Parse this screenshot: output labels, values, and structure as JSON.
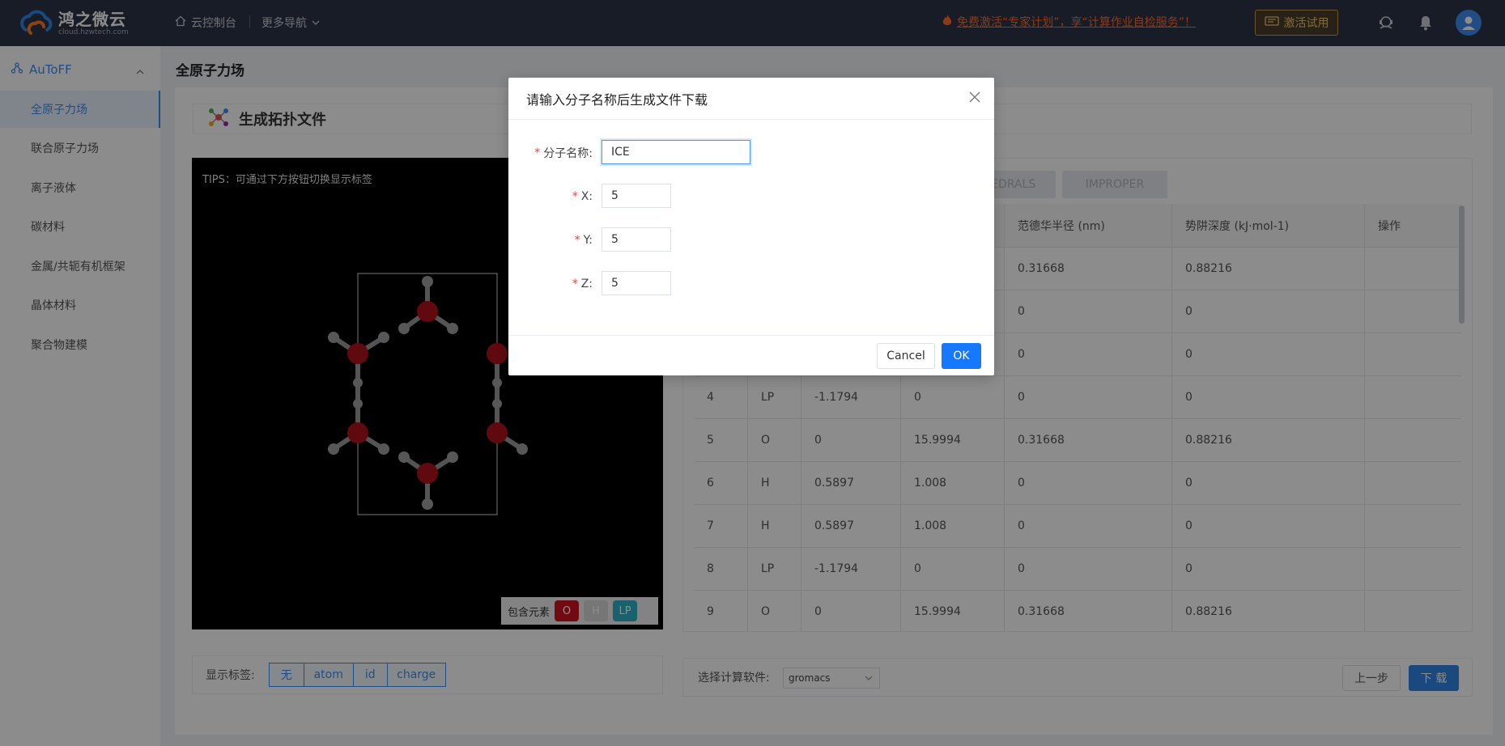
{
  "header": {
    "logo_cn": "鸿之微云",
    "logo_en": "cloud.hzwtech.com",
    "console_label": "云控制台",
    "more_nav_label": "更多导航",
    "promo_text": "免费激活“专家计划”，享“计算作业自检服务”！",
    "trial_label": "激活试用"
  },
  "sidebar": {
    "group_label": "AuToFF",
    "items": [
      {
        "label": "全原子力场"
      },
      {
        "label": "联合原子力场"
      },
      {
        "label": "离子液体"
      },
      {
        "label": "碳材料"
      },
      {
        "label": "金属/共轭有机框架"
      },
      {
        "label": "晶体材料"
      },
      {
        "label": "聚合物建模"
      }
    ]
  },
  "page": {
    "title": "全原子力场",
    "section_title": "生成拓扑文件"
  },
  "viewer": {
    "tips": "TIPS：可通过下方按钮切换显示标签",
    "legend_label": "包含元素",
    "elements": [
      {
        "label": "O",
        "color": "#d0141f"
      },
      {
        "label": "H",
        "color": "#d8d8d8"
      },
      {
        "label": "LP",
        "color": "#2bb3c8"
      }
    ]
  },
  "table": {
    "tabs": [
      "DIHEDRALS",
      "IMPROPER"
    ],
    "headers": [
      "",
      "",
      "",
      "",
      "范德华半径 (nm)",
      "势阱深度 (kJ·mol-1)",
      "操作"
    ],
    "rows": [
      [
        "",
        "",
        "",
        "",
        "0.31668",
        "0.88216",
        ""
      ],
      [
        "",
        "",
        "",
        "",
        "0",
        "0",
        ""
      ],
      [
        "",
        "",
        "",
        "",
        "0",
        "0",
        ""
      ],
      [
        "4",
        "LP",
        "-1.1794",
        "0",
        "0",
        "0",
        ""
      ],
      [
        "5",
        "O",
        "0",
        "15.9994",
        "0.31668",
        "0.88216",
        ""
      ],
      [
        "6",
        "H",
        "0.5897",
        "1.008",
        "0",
        "0",
        ""
      ],
      [
        "7",
        "H",
        "0.5897",
        "1.008",
        "0",
        "0",
        ""
      ],
      [
        "8",
        "LP",
        "-1.1794",
        "0",
        "0",
        "0",
        ""
      ],
      [
        "9",
        "O",
        "0",
        "15.9994",
        "0.31668",
        "0.88216",
        ""
      ]
    ]
  },
  "labels_bar": {
    "label": "显示标签:",
    "options": [
      "无",
      "atom",
      "id",
      "charge"
    ]
  },
  "software_bar": {
    "label": "选择计算软件:",
    "selected": "gromacs",
    "prev_label": "上一步",
    "download_label": "下 载"
  },
  "modal": {
    "title": "请输入分子名称后生成文件下载",
    "fields": [
      {
        "label": "分子名称:",
        "value": "ICE"
      },
      {
        "label": "X:",
        "value": "5"
      },
      {
        "label": "Y:",
        "value": "5"
      },
      {
        "label": "Z:",
        "value": "5"
      }
    ],
    "cancel_label": "Cancel",
    "ok_label": "OK"
  },
  "colors": {
    "accent": "#3e8cf0",
    "header_bg": "#2b3445",
    "promo": "#ff6a2a"
  }
}
